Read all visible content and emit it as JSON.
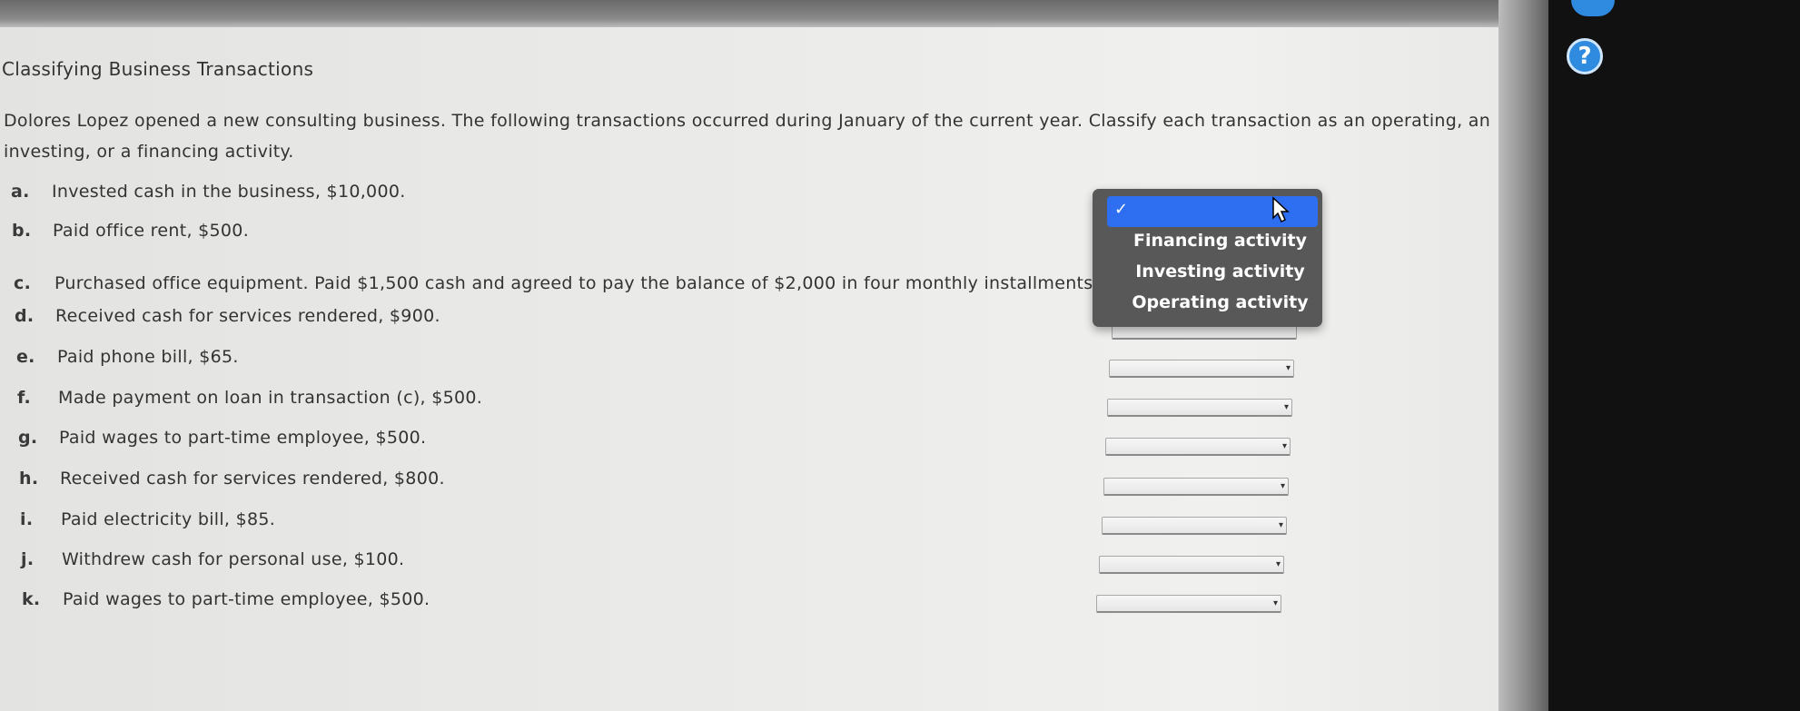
{
  "title": "Classifying Business Transactions",
  "intro": "Dolores Lopez opened a new consulting business. The following transactions occurred during January of the current year. Classify each transaction as an operating, an investing, or a financing activity.",
  "transactions": [
    {
      "letter": "a.",
      "text": "Invested cash in the business, $10,000."
    },
    {
      "letter": "b.",
      "text": "Paid office rent, $500."
    },
    {
      "letter": "c.",
      "text": "Purchased office equipment. Paid $1,500 cash and agreed to pay the balance of $2,000 in four monthly installments."
    },
    {
      "letter": "d.",
      "text": "Received cash for services rendered, $900."
    },
    {
      "letter": "e.",
      "text": "Paid phone bill, $65."
    },
    {
      "letter": "f.",
      "text": "Made payment on loan in transaction (c), $500."
    },
    {
      "letter": "g.",
      "text": "Paid wages to part-time employee, $500."
    },
    {
      "letter": "h.",
      "text": "Received cash for services rendered, $800."
    },
    {
      "letter": "i.",
      "text": "Paid electricity bill, $85."
    },
    {
      "letter": "j.",
      "text": "Withdrew cash for personal use, $100."
    },
    {
      "letter": "k.",
      "text": "Paid wages to part-time employee, $500."
    }
  ],
  "dropdown": {
    "check": "✓",
    "options": [
      "Financing activity",
      "Investing activity",
      "Operating activity"
    ]
  },
  "help": {
    "symbol": "?"
  },
  "icons": {
    "select_arrow": "▾",
    "cursor": "arrow-cursor"
  },
  "colors": {
    "selection": "#2d6ff0",
    "menu_bg": "#585858",
    "help": "#2f8be0"
  }
}
